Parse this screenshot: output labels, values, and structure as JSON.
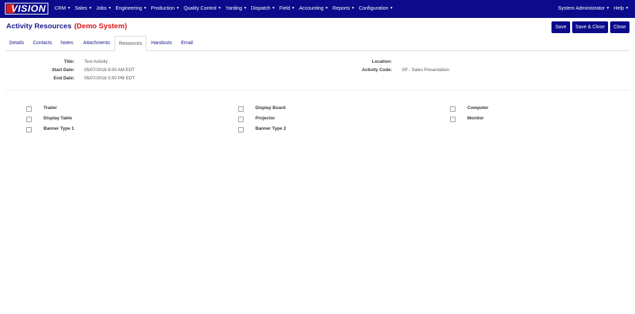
{
  "app": {
    "logo_text": "VISION"
  },
  "nav": {
    "menu": [
      "CRM",
      "Sales",
      "Jobs",
      "Engineering",
      "Production",
      "Quality Control",
      "Yarding",
      "Dispatch",
      "Field",
      "Accounting",
      "Reports",
      "Configuration"
    ],
    "user": "System Administrator",
    "help": "Help"
  },
  "page": {
    "title": "Activity Resources",
    "subtitle": "(Demo System)"
  },
  "buttons": {
    "save": "Save",
    "save_close": "Save & Close",
    "close": "Close"
  },
  "tabs": [
    "Details",
    "Contacts",
    "Notes",
    "Attachments",
    "Resources",
    "Handouts",
    "Email"
  ],
  "active_tab": "Resources",
  "info": {
    "title_label": "Title:",
    "title_value": "Test Activity",
    "start_label": "Start Date:",
    "start_value": "05/07/2018 8:00 AM EDT",
    "end_label": "End Date:",
    "end_value": "05/07/2018 5:00 PM EDT",
    "location_label": "Location:",
    "location_value": "",
    "code_label": "Activity Code:",
    "code_value": "SP - Sales Presentation"
  },
  "resources": [
    [
      "Trailer",
      "Display Board",
      "Computer"
    ],
    [
      "Display Table",
      "Projector",
      "Monitor"
    ],
    [
      "Banner Type 1",
      "Banner Type 2"
    ]
  ],
  "colors": {
    "navbar": "#0b0b8c",
    "title": "#1a1a8c",
    "demo": "#dd1111"
  }
}
